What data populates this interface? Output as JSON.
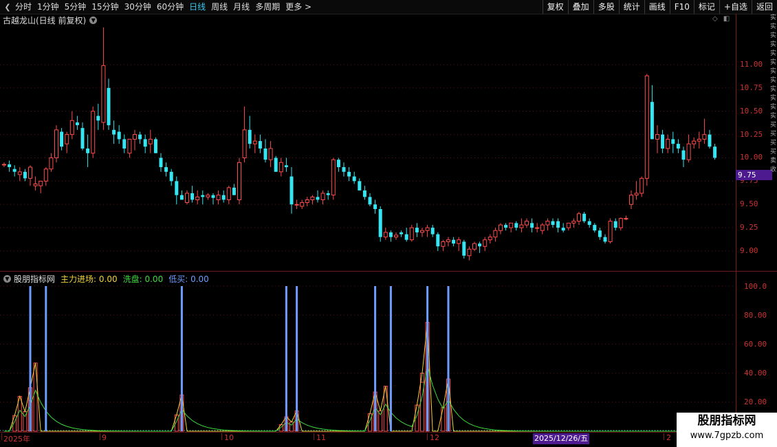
{
  "toolbar": {
    "back_icon": "chevron-left-icon",
    "periods": [
      "分时",
      "1分钟",
      "5分钟",
      "15分钟",
      "30分钟",
      "60分钟",
      "日线",
      "周线",
      "月线",
      "多周期",
      "更多 >"
    ],
    "active_period": "日线",
    "tools": [
      "复权",
      "叠加",
      "多股",
      "统计",
      "画线",
      "F10",
      "标记",
      "+自选",
      "返回"
    ]
  },
  "chart": {
    "title": "古越龙山(日线 前复权)",
    "price_axis": [
      "11.00",
      "10.75",
      "10.50",
      "10.25",
      "10.00",
      "9.75",
      "9.50",
      "9.25",
      "9.00"
    ],
    "current_price": "9.75",
    "colors": {
      "up": "#ff4d4d",
      "down": "#35e6f2",
      "axis": "#cc3333",
      "cursor": "#4d1a8f"
    }
  },
  "indicator": {
    "name": "股朋指标网",
    "fields": [
      {
        "label": "主力进场:",
        "value": "0.00"
      },
      {
        "label": "洗盘:",
        "value": "0.00"
      },
      {
        "label": "低买:",
        "value": "0.00"
      }
    ],
    "axis": [
      "100.0",
      "80.00",
      "60.00",
      "40.00",
      "20.00"
    ]
  },
  "date_axis": {
    "labels": [
      "2025年",
      "9",
      "10",
      "11",
      "12",
      "2"
    ],
    "cursor_date": "2025/12/26/五"
  },
  "edge_text": "实实实实实实实实实实实实买买买买卖收",
  "watermark": {
    "title": "股朋指标网",
    "url": "www.7gpzb.com"
  },
  "chart_data": {
    "type": "candlestick",
    "ohlc": [
      [
        9.93,
        9.95,
        9.9,
        9.93
      ],
      [
        9.93,
        9.97,
        9.85,
        9.9
      ],
      [
        9.88,
        9.92,
        9.8,
        9.85
      ],
      [
        9.82,
        9.9,
        9.75,
        9.85
      ],
      [
        9.85,
        9.88,
        9.75,
        9.78
      ],
      [
        9.78,
        9.92,
        9.7,
        9.9
      ],
      [
        9.7,
        9.8,
        9.65,
        9.72
      ],
      [
        9.7,
        9.75,
        9.62,
        9.75
      ],
      [
        9.75,
        9.9,
        9.7,
        9.88
      ],
      [
        9.88,
        10.05,
        9.85,
        10.0
      ],
      [
        10.0,
        10.35,
        9.95,
        10.3
      ],
      [
        10.28,
        10.32,
        10.08,
        10.12
      ],
      [
        10.15,
        10.28,
        10.05,
        10.25
      ],
      [
        10.25,
        10.5,
        10.2,
        10.4
      ],
      [
        10.38,
        10.45,
        10.3,
        10.35
      ],
      [
        10.32,
        10.38,
        10.08,
        10.1
      ],
      [
        10.1,
        10.25,
        9.9,
        10.05
      ],
      [
        10.05,
        10.55,
        10.0,
        10.5
      ],
      [
        10.45,
        10.58,
        10.3,
        10.4
      ],
      [
        10.38,
        11.4,
        10.3,
        10.99
      ],
      [
        10.75,
        10.85,
        10.3,
        10.35
      ],
      [
        10.3,
        10.4,
        10.15,
        10.25
      ],
      [
        10.28,
        10.35,
        10.15,
        10.2
      ],
      [
        10.2,
        10.25,
        10.05,
        10.1
      ],
      [
        10.05,
        10.2,
        10.0,
        10.2
      ],
      [
        10.2,
        10.3,
        10.08,
        10.25
      ],
      [
        10.25,
        10.28,
        10.15,
        10.2
      ],
      [
        10.2,
        10.25,
        10.05,
        10.12
      ],
      [
        10.15,
        10.3,
        10.05,
        10.2
      ],
      [
        10.2,
        10.22,
        10.05,
        10.05
      ],
      [
        10.0,
        10.05,
        9.85,
        9.9
      ],
      [
        9.9,
        9.95,
        9.8,
        9.85
      ],
      [
        9.85,
        9.88,
        9.7,
        9.75
      ],
      [
        9.75,
        9.8,
        9.5,
        9.6
      ],
      [
        9.6,
        9.65,
        9.55,
        9.55
      ],
      [
        9.52,
        9.65,
        9.5,
        9.62
      ],
      [
        9.62,
        9.7,
        9.52,
        9.55
      ],
      [
        9.55,
        9.65,
        9.5,
        9.58
      ],
      [
        9.6,
        9.65,
        9.5,
        9.58
      ],
      [
        9.58,
        9.62,
        9.55,
        9.6
      ],
      [
        9.6,
        9.62,
        9.5,
        9.57
      ],
      [
        9.55,
        9.65,
        9.5,
        9.6
      ],
      [
        9.6,
        9.65,
        9.52,
        9.55
      ],
      [
        9.55,
        9.7,
        9.5,
        9.68
      ],
      [
        9.68,
        9.72,
        9.6,
        9.6
      ],
      [
        9.55,
        10.0,
        9.5,
        9.95
      ],
      [
        10.0,
        10.55,
        9.95,
        10.3
      ],
      [
        10.3,
        10.45,
        10.1,
        10.15
      ],
      [
        10.15,
        10.25,
        10.05,
        10.18
      ],
      [
        10.18,
        10.25,
        10.05,
        10.1
      ],
      [
        10.1,
        10.2,
        9.95,
        9.98
      ],
      [
        9.98,
        10.18,
        9.9,
        10.1
      ],
      [
        10.0,
        10.02,
        9.85,
        9.85
      ],
      [
        9.85,
        10.0,
        9.8,
        9.95
      ],
      [
        9.92,
        10.0,
        9.85,
        9.9
      ],
      [
        9.8,
        9.9,
        9.4,
        9.5
      ],
      [
        9.5,
        9.55,
        9.45,
        9.5
      ],
      [
        9.48,
        9.55,
        9.45,
        9.52
      ],
      [
        9.52,
        9.58,
        9.48,
        9.55
      ],
      [
        9.55,
        9.6,
        9.5,
        9.58
      ],
      [
        9.58,
        9.65,
        9.52,
        9.55
      ],
      [
        9.55,
        9.65,
        9.5,
        9.62
      ],
      [
        9.62,
        9.65,
        9.55,
        9.6
      ],
      [
        9.6,
        10.0,
        9.55,
        9.98
      ],
      [
        9.98,
        10.0,
        9.85,
        9.9
      ],
      [
        9.9,
        9.95,
        9.8,
        9.85
      ],
      [
        9.85,
        9.9,
        9.75,
        9.8
      ],
      [
        9.8,
        9.85,
        9.72,
        9.75
      ],
      [
        9.75,
        9.78,
        9.65,
        9.65
      ],
      [
        9.65,
        9.7,
        9.55,
        9.58
      ],
      [
        9.58,
        9.62,
        9.48,
        9.5
      ],
      [
        9.5,
        9.55,
        9.4,
        9.45
      ],
      [
        9.45,
        9.48,
        9.1,
        9.15
      ],
      [
        9.15,
        9.25,
        9.12,
        9.2
      ],
      [
        9.2,
        9.22,
        9.1,
        9.15
      ],
      [
        9.15,
        9.2,
        9.12,
        9.17
      ],
      [
        9.2,
        9.22,
        9.15,
        9.18
      ],
      [
        9.18,
        9.25,
        9.1,
        9.12
      ],
      [
        9.12,
        9.28,
        9.1,
        9.25
      ],
      [
        9.25,
        9.3,
        9.15,
        9.2
      ],
      [
        9.2,
        9.25,
        9.15,
        9.22
      ],
      [
        9.22,
        9.28,
        9.15,
        9.25
      ],
      [
        9.25,
        9.28,
        9.15,
        9.18
      ],
      [
        9.18,
        9.2,
        9.0,
        9.05
      ],
      [
        9.05,
        9.12,
        9.0,
        9.1
      ],
      [
        9.1,
        9.15,
        9.05,
        9.12
      ],
      [
        9.12,
        9.15,
        9.05,
        9.08
      ],
      [
        9.08,
        9.15,
        9.0,
        9.12
      ],
      [
        9.1,
        9.12,
        8.92,
        8.95
      ],
      [
        8.95,
        9.05,
        8.9,
        9.02
      ],
      [
        9.02,
        9.1,
        9.0,
        9.08
      ],
      [
        9.08,
        9.1,
        8.98,
        9.05
      ],
      [
        9.05,
        9.15,
        9.0,
        9.12
      ],
      [
        9.12,
        9.18,
        9.08,
        9.15
      ],
      [
        9.15,
        9.25,
        9.1,
        9.22
      ],
      [
        9.22,
        9.3,
        9.18,
        9.28
      ],
      [
        9.28,
        9.3,
        9.22,
        9.25
      ],
      [
        9.25,
        9.3,
        9.2,
        9.3
      ],
      [
        9.3,
        9.32,
        9.22,
        9.25
      ],
      [
        9.25,
        9.35,
        9.2,
        9.28
      ],
      [
        9.28,
        9.35,
        9.25,
        9.32
      ],
      [
        9.3,
        9.35,
        9.2,
        9.25
      ],
      [
        9.25,
        9.3,
        9.2,
        9.25
      ],
      [
        9.22,
        9.3,
        9.18,
        9.28
      ],
      [
        9.28,
        9.35,
        9.22,
        9.32
      ],
      [
        9.32,
        9.35,
        9.25,
        9.28
      ],
      [
        9.32,
        9.35,
        9.2,
        9.25
      ],
      [
        9.25,
        9.3,
        9.2,
        9.22
      ],
      [
        9.25,
        9.3,
        9.22,
        9.3
      ],
      [
        9.3,
        9.35,
        9.25,
        9.32
      ],
      [
        9.32,
        9.42,
        9.28,
        9.4
      ],
      [
        9.4,
        9.42,
        9.3,
        9.32
      ],
      [
        9.32,
        9.35,
        9.25,
        9.28
      ],
      [
        9.28,
        9.3,
        9.2,
        9.22
      ],
      [
        9.22,
        9.25,
        9.12,
        9.15
      ],
      [
        9.15,
        9.18,
        9.08,
        9.1
      ],
      [
        9.1,
        9.35,
        9.08,
        9.32
      ],
      [
        9.32,
        9.35,
        9.22,
        9.25
      ],
      [
        9.25,
        9.36,
        9.22,
        9.35
      ],
      [
        9.35,
        9.38,
        9.33,
        9.35
      ],
      [
        9.5,
        9.65,
        9.45,
        9.6
      ],
      [
        9.6,
        9.75,
        9.55,
        9.62
      ],
      [
        9.62,
        9.8,
        9.58,
        9.78
      ],
      [
        9.78,
        10.9,
        9.7,
        10.88
      ],
      [
        10.6,
        10.78,
        10.2,
        10.2
      ],
      [
        10.2,
        10.35,
        10.05,
        10.25
      ],
      [
        10.25,
        10.3,
        10.05,
        10.1
      ],
      [
        10.1,
        10.25,
        10.05,
        10.2
      ],
      [
        10.2,
        10.28,
        10.05,
        10.15
      ],
      [
        10.15,
        10.2,
        10.05,
        10.1
      ],
      [
        10.08,
        10.12,
        9.9,
        9.98
      ],
      [
        9.98,
        10.25,
        9.95,
        10.15
      ],
      [
        10.15,
        10.22,
        10.1,
        10.18
      ],
      [
        10.18,
        10.28,
        10.1,
        10.2
      ],
      [
        10.2,
        10.42,
        10.15,
        10.25
      ],
      [
        10.25,
        10.3,
        10.1,
        10.12
      ],
      [
        10.12,
        10.15,
        9.98,
        10.0
      ]
    ],
    "indicator_series": {
      "main_force_peaks": [
        [
          3,
          24
        ],
        [
          5,
          30
        ],
        [
          6,
          47
        ],
        [
          34,
          25
        ],
        [
          54,
          10
        ],
        [
          56,
          14
        ],
        [
          71,
          27
        ],
        [
          73,
          31
        ],
        [
          80,
          40
        ],
        [
          81,
          75
        ],
        [
          85,
          36
        ]
      ],
      "low_buy_markers": [
        5,
        8,
        34,
        54,
        56,
        71,
        74,
        81,
        85
      ]
    }
  }
}
